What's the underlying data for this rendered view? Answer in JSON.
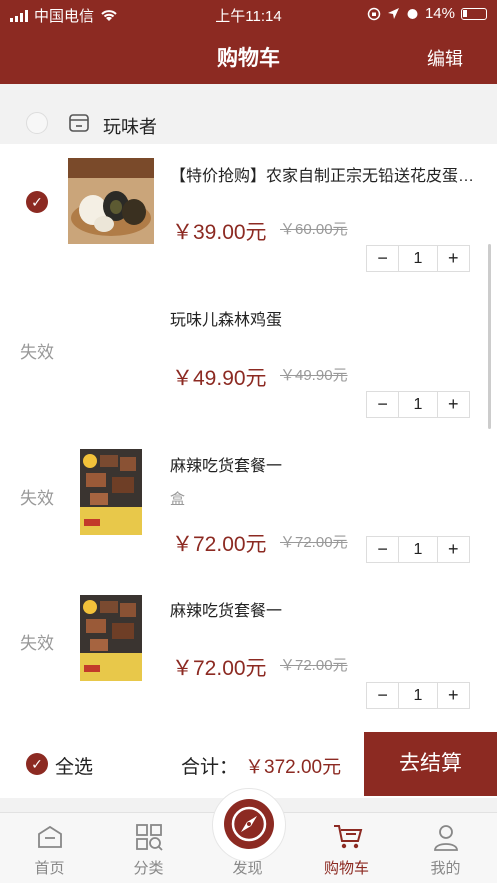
{
  "status_bar": {
    "carrier": "中国电信",
    "time": "上午11:14",
    "battery": "14%"
  },
  "nav": {
    "title": "购物车",
    "edit_label": "编辑"
  },
  "shop": {
    "name": "玩味者"
  },
  "items": [
    {
      "title": "【特价抢购】农家自制正宗无铅送花皮蛋…",
      "price": "￥39.00元",
      "old_price": "￥60.00元",
      "qty": "1",
      "status": "",
      "checked": true,
      "spec": ""
    },
    {
      "title": "玩味儿森林鸡蛋",
      "price": "￥49.90元",
      "old_price": "￥49.90元",
      "qty": "1",
      "status": "失效",
      "checked": false,
      "spec": ""
    },
    {
      "title": "麻辣吃货套餐一",
      "price": "￥72.00元",
      "old_price": "￥72.00元",
      "qty": "1",
      "status": "失效",
      "checked": false,
      "spec": "盒"
    },
    {
      "title": "麻辣吃货套餐一",
      "price": "￥72.00元",
      "old_price": "￥72.00元",
      "qty": "1",
      "status": "失效",
      "checked": false,
      "spec": ""
    }
  ],
  "stepper": {
    "minus": "−",
    "plus": "+"
  },
  "footer": {
    "select_all": "全选",
    "total_label": "合计：",
    "total_value": "￥372.00元",
    "checkout": "去结算"
  },
  "tabs": [
    {
      "label": "首页",
      "icon": "home-icon"
    },
    {
      "label": "分类",
      "icon": "category-icon"
    },
    {
      "label": "发现",
      "icon": "compass-icon"
    },
    {
      "label": "购物车",
      "icon": "cart-icon",
      "active": true
    },
    {
      "label": "我的",
      "icon": "user-icon"
    }
  ],
  "colors": {
    "brand": "#8c2a22",
    "muted": "#999999"
  }
}
